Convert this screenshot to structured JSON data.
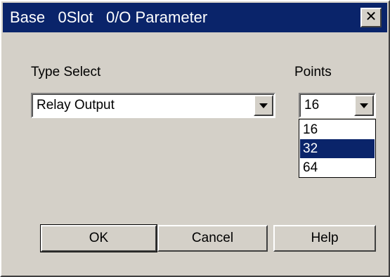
{
  "window": {
    "title": "Base   0Slot   0/O Parameter",
    "close_glyph": "✕"
  },
  "type_select": {
    "label": "Type Select",
    "value": "Relay Output"
  },
  "points": {
    "label": "Points",
    "value": "16",
    "options": [
      "16",
      "32",
      "64"
    ],
    "highlighted_option": "32"
  },
  "buttons": {
    "ok": "OK",
    "cancel": "Cancel",
    "help": "Help"
  },
  "colors": {
    "titlebar": "#0a246a",
    "face": "#d4d0c8",
    "highlight": "#0a246a"
  }
}
